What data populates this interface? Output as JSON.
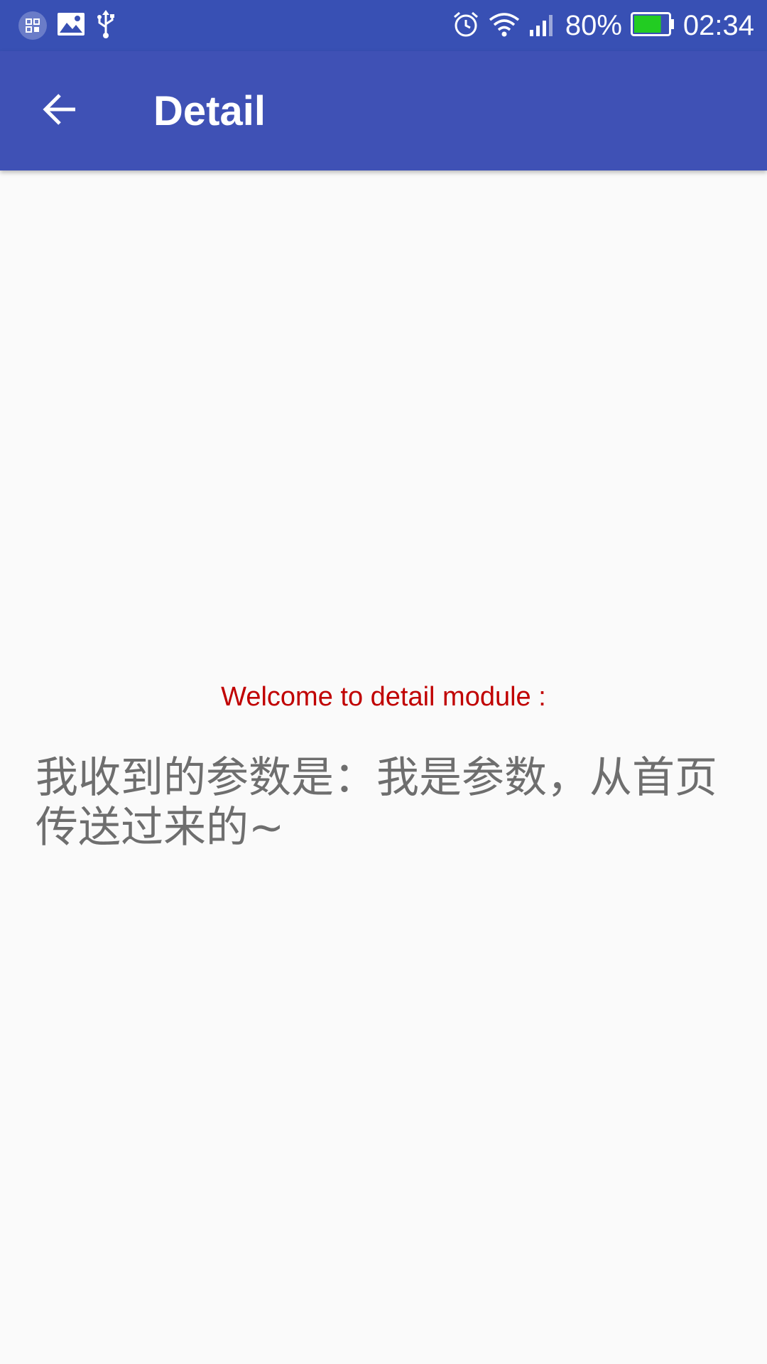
{
  "status_bar": {
    "left_icons": [
      "screenshot-notification-icon",
      "image-notification-icon",
      "usb-icon"
    ],
    "right_icons": [
      "alarm-icon",
      "wifi-icon",
      "signal-icon",
      "battery-icon"
    ],
    "battery_percent": "80%",
    "battery_level": 0.8,
    "time": "02:34",
    "colors": {
      "status_bar_bg": "#3850b4",
      "battery_fill": "#22cc22"
    }
  },
  "app_bar": {
    "back_icon": "arrow-back-icon",
    "title": "Detail",
    "color": "#3f51b5"
  },
  "content": {
    "welcome_text": "Welcome to detail module :",
    "welcome_color": "#c00000",
    "param_text": "我收到的参数是：我是参数，从首页传送过来的~"
  }
}
